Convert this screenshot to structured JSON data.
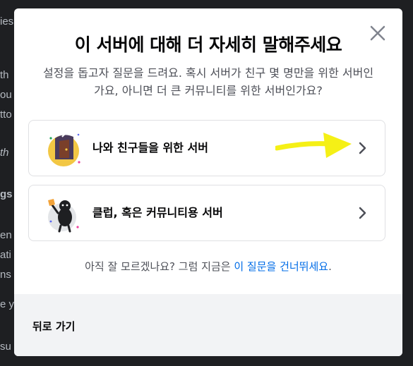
{
  "background": {
    "fragments": [
      "ies",
      "th",
      "ou",
      "tto",
      "th",
      "gs",
      "en",
      "ati",
      "ns",
      "e y",
      "su"
    ]
  },
  "modal": {
    "close_icon": "close-icon",
    "title": "이 서버에 대해 더 자세히 말해주세요",
    "subtitle": "설정을 돕고자 질문을 드려요. 혹시 서버가 친구 몇 명만을 위한 서버인가요, 아니면 더 큰 커뮤니티를 위한 서버인가요?",
    "options": [
      {
        "label": "나와 친구들을 위한 서버",
        "icon": "door-illustration-icon"
      },
      {
        "label": "클럽, 혹은 커뮤니티용 서버",
        "icon": "club-illustration-icon"
      }
    ],
    "skip_prefix": "아직 잘 모르겠나요? 그럼 지금은 ",
    "skip_link": "이 질문을 건너뛰세요",
    "skip_suffix": ".",
    "back_label": "뒤로 가기"
  },
  "colors": {
    "link": "#006ce7",
    "annotation_arrow": "#f5f016",
    "footer_bg": "#f2f3f5"
  }
}
